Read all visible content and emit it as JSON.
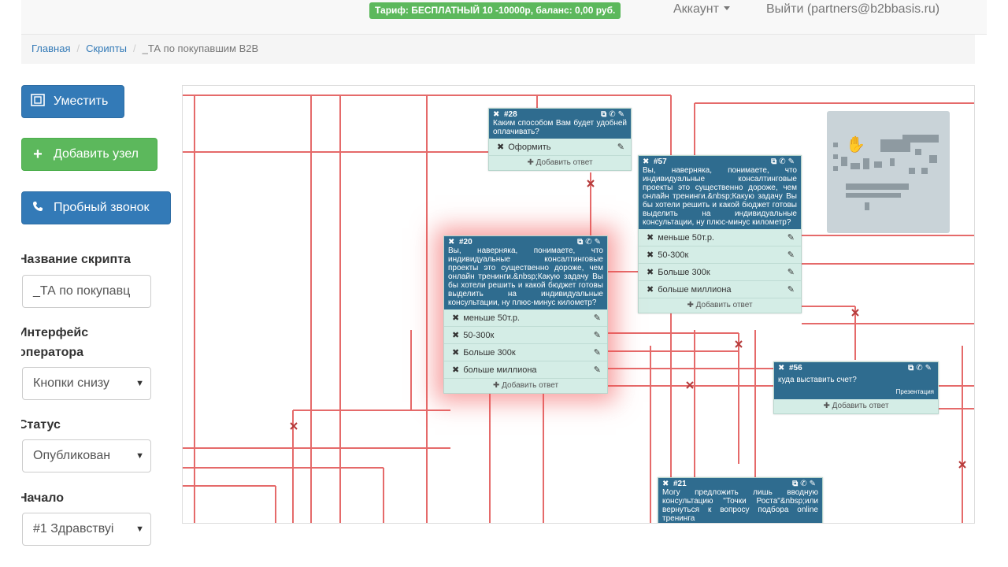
{
  "topbar": {
    "tariff": "Тариф: БЕСПЛАТНЫЙ 10 -10000р, баланс: 0,00 руб.",
    "account": "Аккаунт",
    "logout": "Выйти (partners@b2bbasis.ru)"
  },
  "breadcrumb": {
    "home": "Главная",
    "scripts": "Скрипты",
    "current": "_ТА по покупавшим В2В"
  },
  "sidebar": {
    "fit_button": "Уместить",
    "add_node_button": "Добавить узел",
    "test_call_button": "Пробный звонок",
    "script_name_label": "Название скрипта",
    "script_name_value": "_ТА по покупавц",
    "interface_label_1": "Интерфейс",
    "interface_label_2": "оператора",
    "interface_value": "Кнопки снизу",
    "status_label": "Статус",
    "status_value": "Опубликован",
    "start_label": "Начало",
    "start_value": "#1 Здравствуі"
  },
  "nodes": {
    "n28": {
      "id": "#28",
      "question": "Каким способом Вам будет удобней оплачивать?",
      "answers": [
        "Оформить"
      ],
      "add": "Добавить ответ"
    },
    "n57": {
      "id": "#57",
      "question": "Вы, наверняка, понимаете, что индивидуальные консалтинговые проекты это существенно дороже, чем онлайн тренинги.&nbsp;Какую задачу Вы бы хотели решить и какой бюджет готовы выделить на индивидуальные консультации, ну плюс-минус километр?",
      "answers": [
        "меньше 50т.р.",
        "50-300к",
        "Больше 300к",
        "больше миллиона"
      ],
      "add": "Добавить ответ"
    },
    "n20": {
      "id": "#20",
      "question": "Вы, наверняка, понимаете, что индивидуальные консалтинговые проекты это существенно дороже, чем онлайн тренинги.&nbsp;Какую задачу Вы бы хотели решить и какой бюджет готовы выделить на индивидуальные консультации, ну плюс-минус километр?",
      "answers": [
        "меньше 50т.р.",
        "50-300к",
        "Больше 300к",
        "больше миллиона"
      ],
      "add": "Добавить ответ"
    },
    "n56": {
      "id": "#56",
      "question": "куда выставить счет?",
      "sub": "Презентация",
      "add": "Добавить ответ"
    },
    "n21": {
      "id": "#21",
      "question": "Могу предложить лишь вводную консультацию \"Точки Роста\"&nbsp;или вернуться к вопросу подбора online тренинга"
    }
  },
  "icons": {
    "fit": "fit-screen-icon",
    "add": "plus-icon",
    "call": "phone-icon"
  }
}
